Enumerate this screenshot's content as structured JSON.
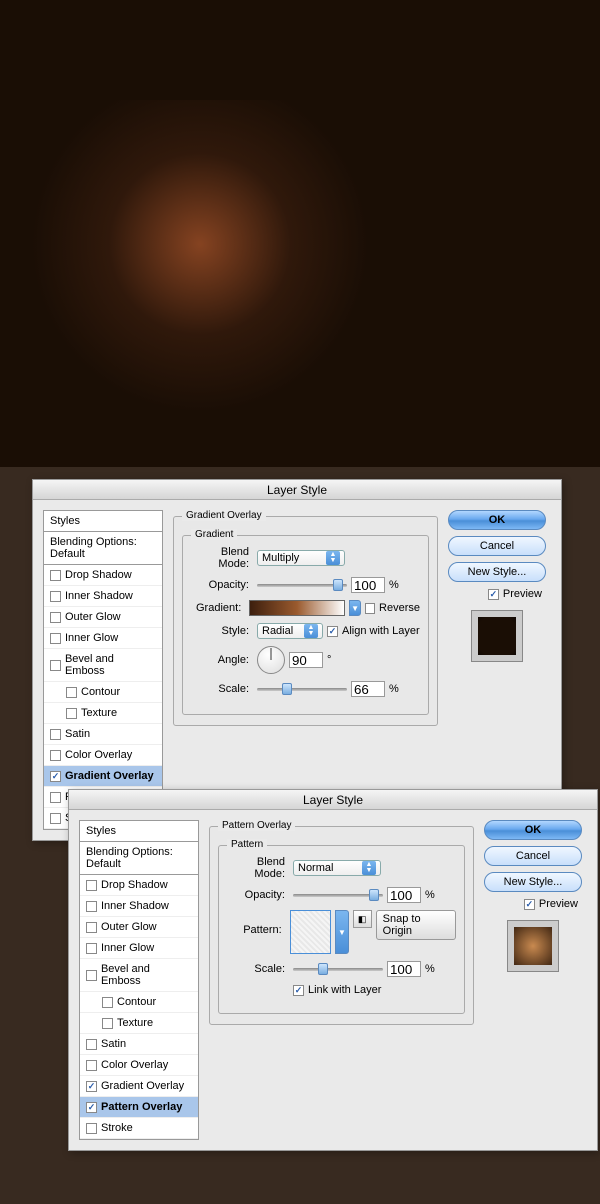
{
  "dialog_title": "Layer Style",
  "styles_header": "Styles",
  "blending_header": "Blending Options: Default",
  "styles_list": {
    "drop_shadow": "Drop Shadow",
    "inner_shadow": "Inner Shadow",
    "outer_glow": "Outer Glow",
    "inner_glow": "Inner Glow",
    "bevel_emboss": "Bevel and Emboss",
    "contour": "Contour",
    "texture": "Texture",
    "satin": "Satin",
    "color_overlay": "Color Overlay",
    "gradient_overlay": "Gradient Overlay",
    "pattern_overlay": "Pattern Overlay",
    "stroke": "Stroke"
  },
  "buttons": {
    "ok": "OK",
    "cancel": "Cancel",
    "new_style": "New Style...",
    "preview": "Preview",
    "snap_to_origin": "Snap to Origin"
  },
  "labels": {
    "blend_mode": "Blend Mode:",
    "opacity": "Opacity:",
    "gradient": "Gradient:",
    "style": "Style:",
    "angle": "Angle:",
    "scale": "Scale:",
    "reverse": "Reverse",
    "align_with_layer": "Align with Layer",
    "link_with_layer": "Link with Layer",
    "pattern": "Pattern:",
    "percent": "%",
    "deg": "°"
  },
  "grad_panel": {
    "title": "Gradient Overlay",
    "sub": "Gradient",
    "blend_mode": "Multiply",
    "opacity": "100",
    "style": "Radial",
    "angle": "90",
    "scale": "66"
  },
  "pat_panel": {
    "title": "Pattern Overlay",
    "sub": "Pattern",
    "blend_mode": "Normal",
    "opacity": "100",
    "scale": "100"
  }
}
